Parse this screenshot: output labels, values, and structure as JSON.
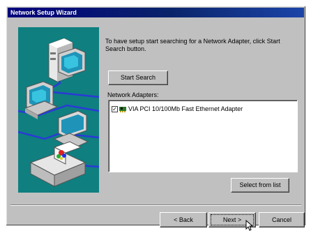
{
  "window": {
    "title": "Network Setup Wizard"
  },
  "instruction": "To have setup start searching for a Network Adapter, click Start Search button.",
  "buttons": {
    "start_search": "Start Search",
    "select_from_list": "Select from list",
    "back": "< Back",
    "next": "Next >",
    "cancel": "Cancel"
  },
  "adapters": {
    "label": "Network Adapters:",
    "items": [
      {
        "label": "VIA PCI 10/100Mb Fast Ethernet Adapter",
        "checked": true
      }
    ]
  },
  "colors": {
    "titlebar": "#00007c",
    "illustration_bg": "#0f7f80",
    "dialog_bg": "#c0c0c0"
  },
  "icons": [
    "network-computers-illustration",
    "network-adapter-icon",
    "mouse-cursor-icon"
  ]
}
